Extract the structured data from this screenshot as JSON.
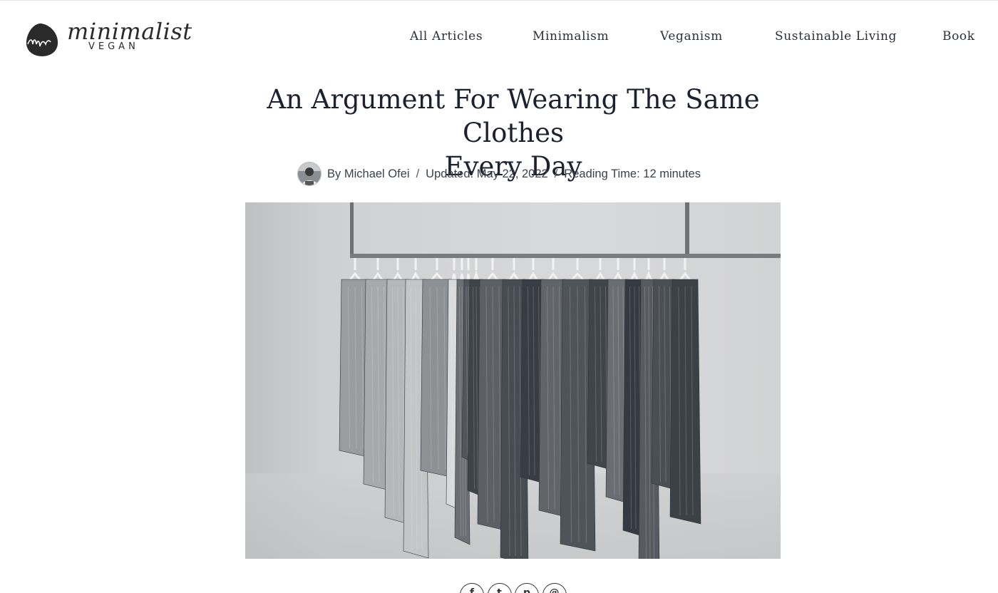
{
  "site": {
    "logo_word": "minimalist",
    "logo_sub": "VEGAN"
  },
  "nav": {
    "items": [
      "All Articles",
      "Minimalism",
      "Veganism",
      "Sustainable Living",
      "Book"
    ]
  },
  "article": {
    "title_line1": "An Argument For Wearing The Same Clothes",
    "title_line2": "Every Day",
    "author": "By Michael Ofei",
    "separator": "/",
    "updated": "Updated: May 22, 2022",
    "reading_time": "Reading Time: 12 minutes"
  },
  "hero_image": {
    "subject": "clothes-rack-photo"
  },
  "share": {
    "icons": [
      "facebook-icon",
      "twitter-icon",
      "pinterest-icon",
      "email-icon"
    ],
    "glyphs": [
      "f",
      "t",
      "p",
      "@"
    ]
  },
  "colors": {
    "text": "#1c2130",
    "nav": "#2b2f38",
    "meta": "#3a3f4a"
  }
}
